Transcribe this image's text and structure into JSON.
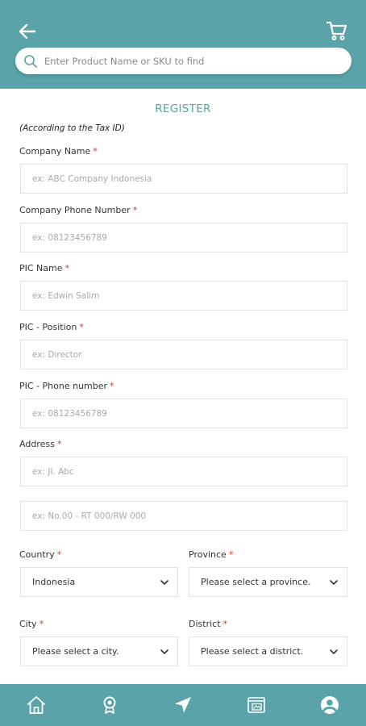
{
  "header": {
    "search_placeholder": "Enter Product Name or SKU to find",
    "back_icon": "arrow-left-icon",
    "cart_icon": "cart-icon"
  },
  "form": {
    "title": "REGISTER",
    "note": "(According to the Tax ID)",
    "required_mark": "*",
    "company_name": {
      "label": "Company Name",
      "placeholder": "ex: ABC Company Indonesia"
    },
    "company_phone": {
      "label": "Company Phone Number",
      "placeholder": "ex: 08123456789"
    },
    "pic_name": {
      "label": "PIC Name",
      "placeholder": "ex: Edwin Salim"
    },
    "pic_position": {
      "label": "PIC - Position",
      "placeholder": "ex: Director"
    },
    "pic_phone": {
      "label": "PIC - Phone number",
      "placeholder": "ex: 08123456789"
    },
    "address": {
      "label": "Address",
      "placeholder_1": "ex: Jl. Abc",
      "placeholder_2": "ex: No.00 - RT 000/RW 000"
    },
    "country": {
      "label": "Country",
      "value": "Indonesia"
    },
    "province": {
      "label": "Province",
      "value": "Please select a province."
    },
    "city": {
      "label": "City",
      "value": "Please select a city."
    },
    "district": {
      "label": "District",
      "value": "Please select a district."
    }
  },
  "bottom_nav": {
    "items": [
      "home-icon",
      "badge-icon",
      "navigation-icon",
      "catalog-icon",
      "account-icon"
    ]
  },
  "colors": {
    "brand": "#5aa3a8",
    "required": "#d33333"
  }
}
